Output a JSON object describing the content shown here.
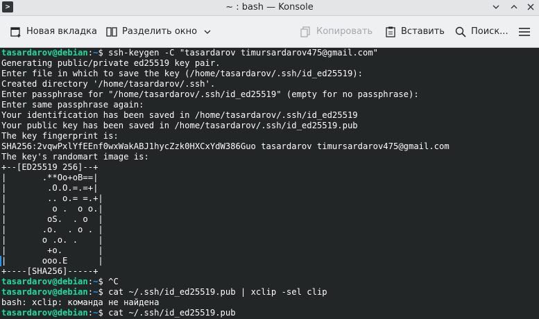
{
  "window": {
    "title": "~ : bash — Konsole",
    "app_icon_glyph": ">"
  },
  "toolbar": {
    "new_tab_label": "Новая вкладка",
    "split_view_label": "Разделить окно",
    "copy_label": "Копировать",
    "paste_label": "Вставить",
    "find_label": "Поиск..."
  },
  "terminal": {
    "colors": {
      "background": "#232627",
      "text": "#fcfcfc",
      "user": "#1cdc9a",
      "path": "#1d99f3"
    },
    "lines": [
      {
        "type": "prompt",
        "user": "tasardarov@debian",
        "sep": ":",
        "path": "~",
        "sym": "$ ",
        "cmd": "ssh-keygen -C \"tasardarov timursardarov475@gmail.com\""
      },
      {
        "type": "out",
        "text": "Generating public/private ed25519 key pair."
      },
      {
        "type": "out",
        "text": "Enter file in which to save the key (/home/tasardarov/.ssh/id_ed25519):"
      },
      {
        "type": "out",
        "text": "Created directory '/home/tasardarov/.ssh'."
      },
      {
        "type": "out",
        "text": "Enter passphrase for \"/home/tasardarov/.ssh/id_ed25519\" (empty for no passphrase):"
      },
      {
        "type": "out",
        "text": "Enter same passphrase again:"
      },
      {
        "type": "out",
        "text": "Your identification has been saved in /home/tasardarov/.ssh/id_ed25519"
      },
      {
        "type": "out",
        "text": "Your public key has been saved in /home/tasardarov/.ssh/id_ed25519.pub"
      },
      {
        "type": "out",
        "text": "The key fingerprint is:"
      },
      {
        "type": "out",
        "text": "SHA256:2vqwPxlYfEEnf0wxWakABJ1hycZzk0HXCxYdW386Guo tasardarov timursardarov475@gmail.com"
      },
      {
        "type": "out",
        "text": "The key's randomart image is:"
      },
      {
        "type": "out",
        "text": "+--[ED25519 256]--+"
      },
      {
        "type": "out",
        "text": "|       .**Oo+oB==|"
      },
      {
        "type": "out",
        "text": "|        .O.O.=.=+|"
      },
      {
        "type": "out",
        "text": "|        .. o.= =.+|"
      },
      {
        "type": "out",
        "text": "|         o .  o o.|"
      },
      {
        "type": "out",
        "text": "|        oS.  . o  |"
      },
      {
        "type": "out",
        "text": "|       .o.  . o . |"
      },
      {
        "type": "out",
        "text": "|       o .o. .    |"
      },
      {
        "type": "out",
        "text": "|        +o.       |"
      },
      {
        "type": "out",
        "text": "|       ooo.E      |"
      },
      {
        "type": "out",
        "text": "+----[SHA256]-----+"
      },
      {
        "type": "prompt",
        "user": "tasardarov@debian",
        "sep": ":",
        "path": "~",
        "sym": "$ ",
        "cmd": "^C"
      },
      {
        "type": "prompt",
        "user": "tasardarov@debian",
        "sep": ":",
        "path": "~",
        "sym": "$ ",
        "cmd": "cat ~/.ssh/id_ed25519.pub | xclip -sel clip"
      },
      {
        "type": "out",
        "text": "bash: xclip: команда не найдена"
      },
      {
        "type": "prompt",
        "user": "tasardarov@debian",
        "sep": ":",
        "path": "~",
        "sym": "$ ",
        "cmd": "cat ~/.ssh/id_ed25519.pub"
      }
    ]
  }
}
